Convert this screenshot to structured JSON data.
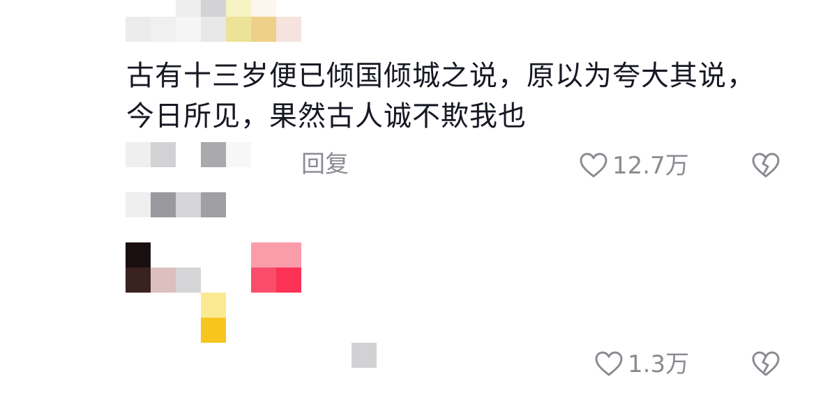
{
  "comments": [
    {
      "text": "古有十三岁便已倾国倾城之说，原以为夸大其说，今日所见，果然古人诚不欺我也",
      "reply_label": "回复",
      "likes": "12.7万"
    },
    {
      "likes": "1.3万"
    }
  ],
  "icons": {
    "like": "heart-outline-icon",
    "dislike": "broken-heart-icon"
  },
  "colors": {
    "text": "#161823",
    "secondary": "#8a8b91"
  }
}
